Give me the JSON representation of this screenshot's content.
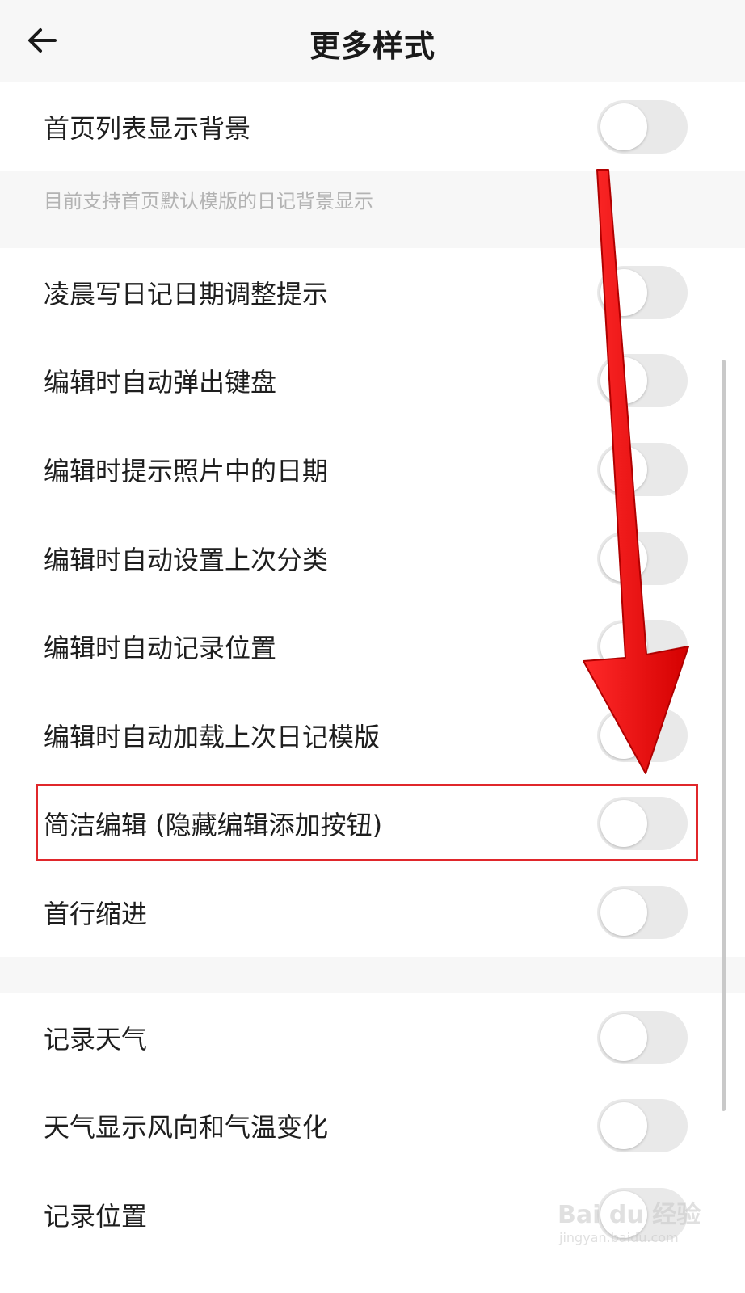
{
  "header": {
    "back_icon": "arrow-left-icon",
    "title": "更多样式"
  },
  "section1": {
    "items": [
      {
        "label": "首页列表显示背景",
        "enabled": false
      }
    ],
    "note": "目前支持首页默认模版的日记背景显示"
  },
  "section2": {
    "items": [
      {
        "label": "凌晨写日记日期调整提示",
        "enabled": false
      },
      {
        "label": "编辑时自动弹出键盘",
        "enabled": false
      },
      {
        "label": "编辑时提示照片中的日期",
        "enabled": false
      },
      {
        "label": "编辑时自动设置上次分类",
        "enabled": false
      },
      {
        "label": "编辑时自动记录位置",
        "enabled": false
      },
      {
        "label": "编辑时自动加载上次日记模版",
        "enabled": false
      },
      {
        "label": "简洁编辑 (隐藏编辑添加按钮)",
        "enabled": false
      },
      {
        "label": "首行缩进",
        "enabled": false
      }
    ]
  },
  "section3": {
    "items": [
      {
        "label": "记录天气",
        "enabled": false
      },
      {
        "label": "天气显示风向和气温变化",
        "enabled": false
      },
      {
        "label": "记录位置",
        "enabled": false
      }
    ]
  },
  "annotation": {
    "arrow_color": "#ff1a1a",
    "highlight_color": "#e0272b"
  },
  "watermark": {
    "logo_text": "Bai du 经验",
    "sub_text": "jingyan.baidu.com"
  }
}
